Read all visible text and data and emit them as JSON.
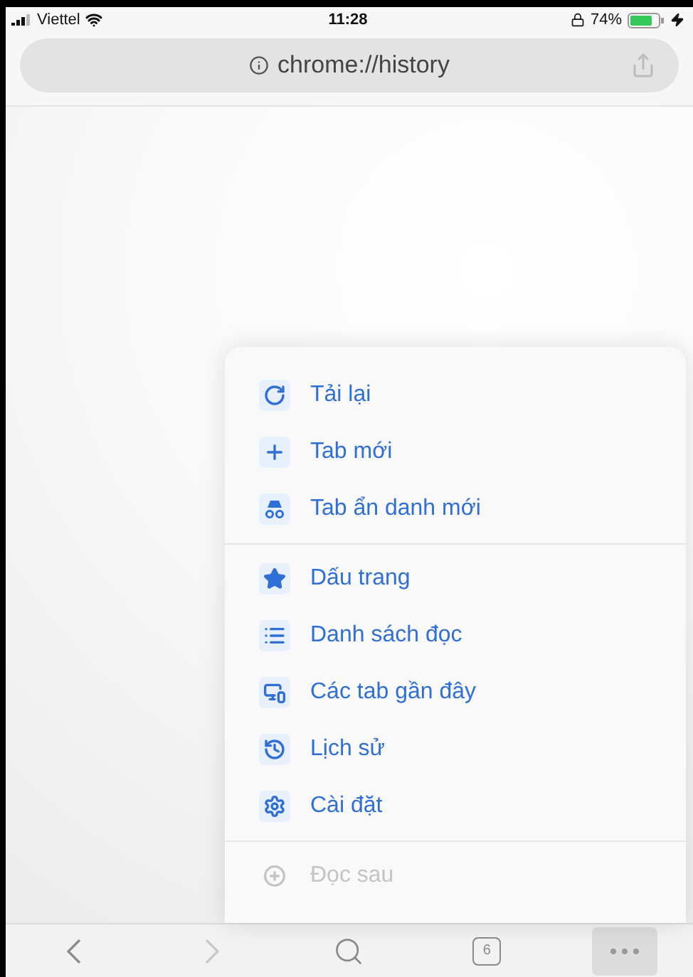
{
  "status_bar": {
    "carrier": "Viettel",
    "time": "11:28",
    "battery": "74%"
  },
  "address_bar": {
    "url": "chrome://history"
  },
  "menu": {
    "groups": [
      {
        "items": [
          {
            "label": "Tải lại",
            "disabled": false
          },
          {
            "label": "Tab mới",
            "disabled": false
          },
          {
            "label": "Tab ẩn danh mới",
            "disabled": false
          }
        ]
      },
      {
        "items": [
          {
            "label": "Dấu trang",
            "disabled": false
          },
          {
            "label": "Danh sách đọc",
            "disabled": false
          },
          {
            "label": "Các tab gần đây",
            "disabled": false
          },
          {
            "label": "Lịch sử",
            "disabled": false
          },
          {
            "label": "Cài đặt",
            "disabled": false
          }
        ]
      },
      {
        "items": [
          {
            "label": "Đọc sau",
            "disabled": true
          }
        ]
      }
    ]
  },
  "toolbar": {
    "back": {
      "disabled": false
    },
    "forward": {
      "disabled": true
    },
    "tab_count": "6",
    "menu_button": {
      "selected": true
    }
  }
}
